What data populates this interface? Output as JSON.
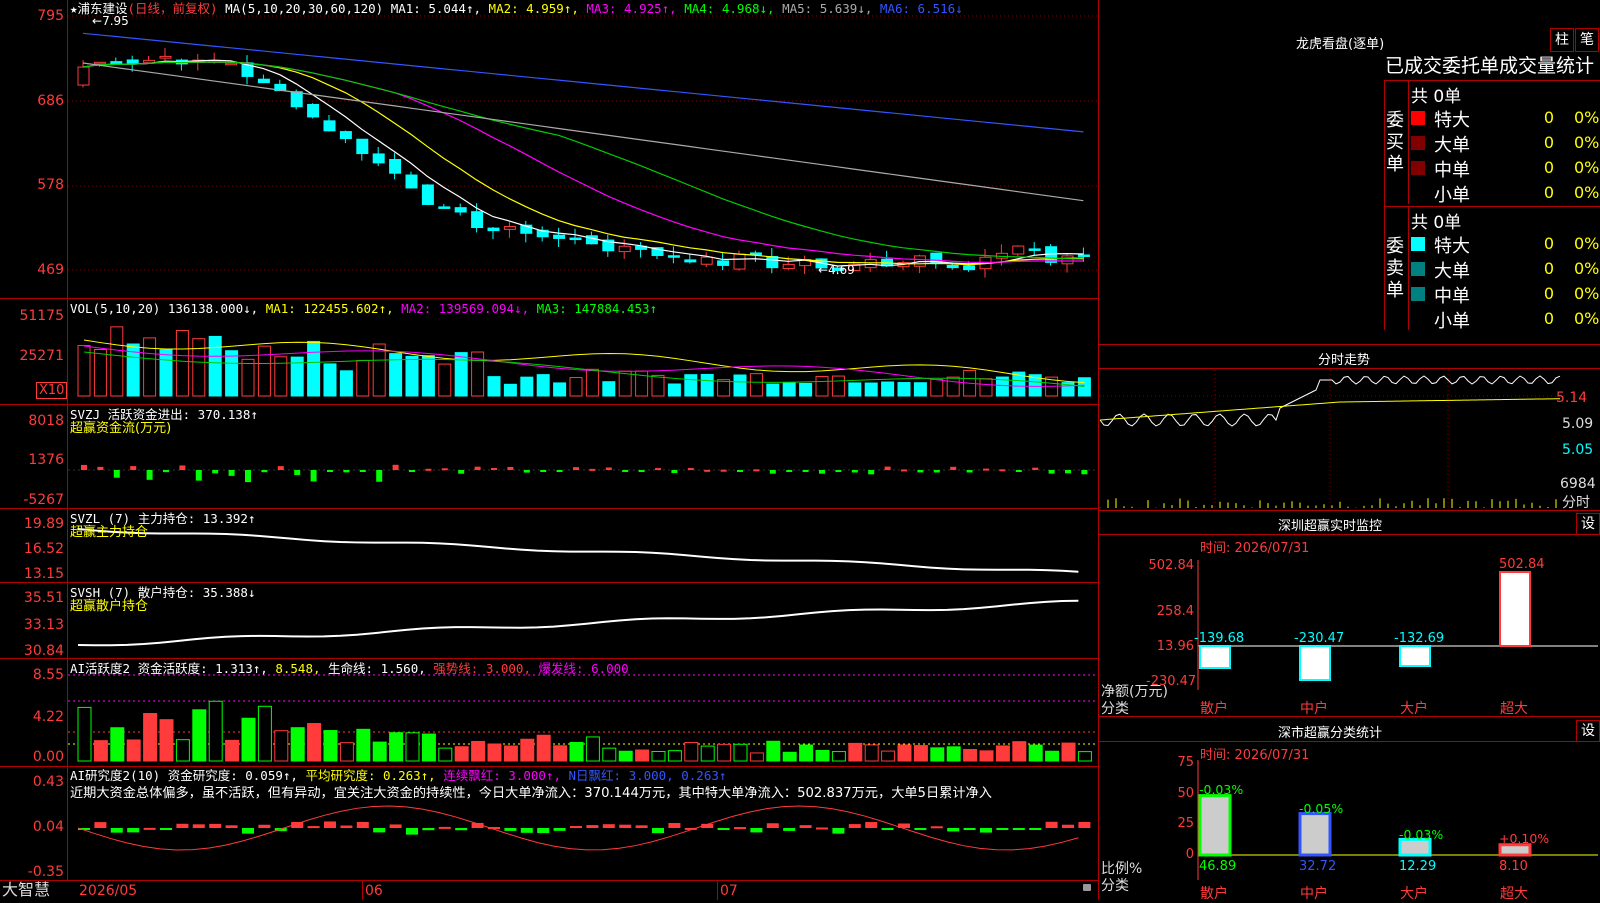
{
  "stock": {
    "name": "★浦东建设",
    "period": "(日线，前复权)"
  },
  "ma_line": {
    "label": "MA(5,10,20,30,60,120)",
    "items": [
      {
        "text": "MA1: 5.044↑",
        "color": "#ffffff"
      },
      {
        "text": "MA2: 4.959↑",
        "color": "#ffff00"
      },
      {
        "text": "MA3: 4.925↑",
        "color": "#ff00ff"
      },
      {
        "text": "MA4: 4.968↓",
        "color": "#00ff00"
      },
      {
        "text": "MA5: 5.639↓",
        "color": "#aaaaaa"
      },
      {
        "text": "MA6: 6.516↓",
        "color": "#3355ff"
      }
    ]
  },
  "price_axis": [
    "795",
    "686",
    "578",
    "469"
  ],
  "price_annotations": {
    "high": "7.95",
    "low": "4.69"
  },
  "vol": {
    "label": "VOL(5,10,20)",
    "items": [
      {
        "text": "136138.000↓",
        "color": "#ffffff"
      },
      {
        "text": "MA1: 122455.602↑",
        "color": "#ffff00"
      },
      {
        "text": "MA2: 139569.094↓",
        "color": "#ff00ff"
      },
      {
        "text": "MA3: 147884.453↑",
        "color": "#00ff00"
      }
    ],
    "axis": [
      "51175",
      "25271"
    ],
    "unit": "X10"
  },
  "svzj": {
    "label": "SVZJ  活跃资金进出: 370.138↑",
    "sub": "超赢资金流(万元)",
    "axis": [
      "8018",
      "1376",
      "-5267"
    ]
  },
  "svzl": {
    "label": "SVZL (7) 主力持仓: 13.392↑",
    "sub": "超赢主力持仓",
    "axis": [
      "19.89",
      "16.52",
      "13.15"
    ]
  },
  "svsh": {
    "label": "SVSH (7) 散户持仓: 35.388↓",
    "sub": "超赢散户持仓",
    "axis": [
      "35.51",
      "33.13",
      "30.84"
    ]
  },
  "ai_active": {
    "items": [
      {
        "text": "AI活跃度2 资金活跃度: 1.313↑",
        "color": "#ffffff"
      },
      {
        "text": "8.548",
        "color": "#ffff00"
      },
      {
        "text": "生命线: 1.560",
        "color": "#ffffff"
      },
      {
        "text": "强势线: 3.000",
        "color": "#ff3b3b"
      },
      {
        "text": "爆发线: 6.000",
        "color": "#ff00ff"
      }
    ],
    "axis": [
      "8.55",
      "4.22",
      "0.00"
    ]
  },
  "ai_research": {
    "items": [
      {
        "text": "AI研究度2(10) 资金研究度: 0.059↑",
        "color": "#ffffff"
      },
      {
        "text": "平均研究度: 0.263↑",
        "color": "#ffff00"
      },
      {
        "text": "连续飘红: 3.000↑",
        "color": "#ff00ff"
      },
      {
        "text": "N日飘红: 3.000, 0.263↑",
        "color": "#3355ff"
      }
    ],
    "comment": "近期大资金总体偏多，虽不活跃，但有异动，宜关注大资金的持续性，今日大单净流入：370.144万元，其中特大单净流入：502.837万元，大单5日累计净入",
    "axis": [
      "0.43",
      "0.04",
      "-0.35"
    ]
  },
  "date_axis": {
    "brand": "大智慧",
    "labels": [
      "2026/05",
      "06",
      "07"
    ]
  },
  "dragon": {
    "title": "龙虎看盘(逐单)",
    "btn1": "柱",
    "btn2": "笔",
    "subtitle": "已成交委托单成交量统计",
    "buy": {
      "label": "委买单",
      "total": "共 0单",
      "rows": [
        {
          "name": "特大",
          "count": "0",
          "pct": "0%",
          "color": "#ff0000"
        },
        {
          "name": "大单",
          "count": "0",
          "pct": "0%",
          "color": "#800000"
        },
        {
          "name": "中单",
          "count": "0",
          "pct": "0%",
          "color": "#800000"
        },
        {
          "name": "小单",
          "count": "0",
          "pct": "0%",
          "color": "#000000"
        }
      ]
    },
    "sell": {
      "label": "委卖单",
      "total": "共 0单",
      "rows": [
        {
          "name": "特大",
          "count": "0",
          "pct": "0%",
          "color": "#00ffff"
        },
        {
          "name": "大单",
          "count": "0",
          "pct": "0%",
          "color": "#008080"
        },
        {
          "name": "中单",
          "count": "0",
          "pct": "0%",
          "color": "#008080"
        },
        {
          "name": "小单",
          "count": "0",
          "pct": "0%",
          "color": "#000000"
        }
      ]
    }
  },
  "intraday": {
    "title": "分时走势",
    "axis": [
      "5.14",
      "5.09",
      "5.05"
    ],
    "vol_value": "6984",
    "vol_unit": "分时"
  },
  "monitor": {
    "title": "深圳超赢实时监控",
    "btn": "设",
    "time": "时间: 2026/07/31",
    "axis": [
      "502.84",
      "258.4",
      "13.96",
      "-230.47"
    ],
    "ylabel": "净额(万元)",
    "xlabel": "分类",
    "categories": [
      "散户",
      "中户",
      "大户",
      "超大"
    ],
    "values": [
      "-139.68",
      "-230.47",
      "-132.69",
      "502.84"
    ]
  },
  "classify": {
    "title": "深市超赢分类统计",
    "btn": "设",
    "time": "时间: 2026/07/31",
    "axis": [
      "75",
      "50",
      "25",
      "0"
    ],
    "ylabel": "比例%",
    "xlabel": "分类",
    "categories": [
      "散户",
      "中户",
      "大户",
      "超大"
    ],
    "values": [
      "46.89",
      "32.72",
      "12.29",
      "8.10"
    ],
    "changes": [
      "-0.03%",
      "-0.05%",
      "-0.03%",
      "+0.10%"
    ]
  }
}
